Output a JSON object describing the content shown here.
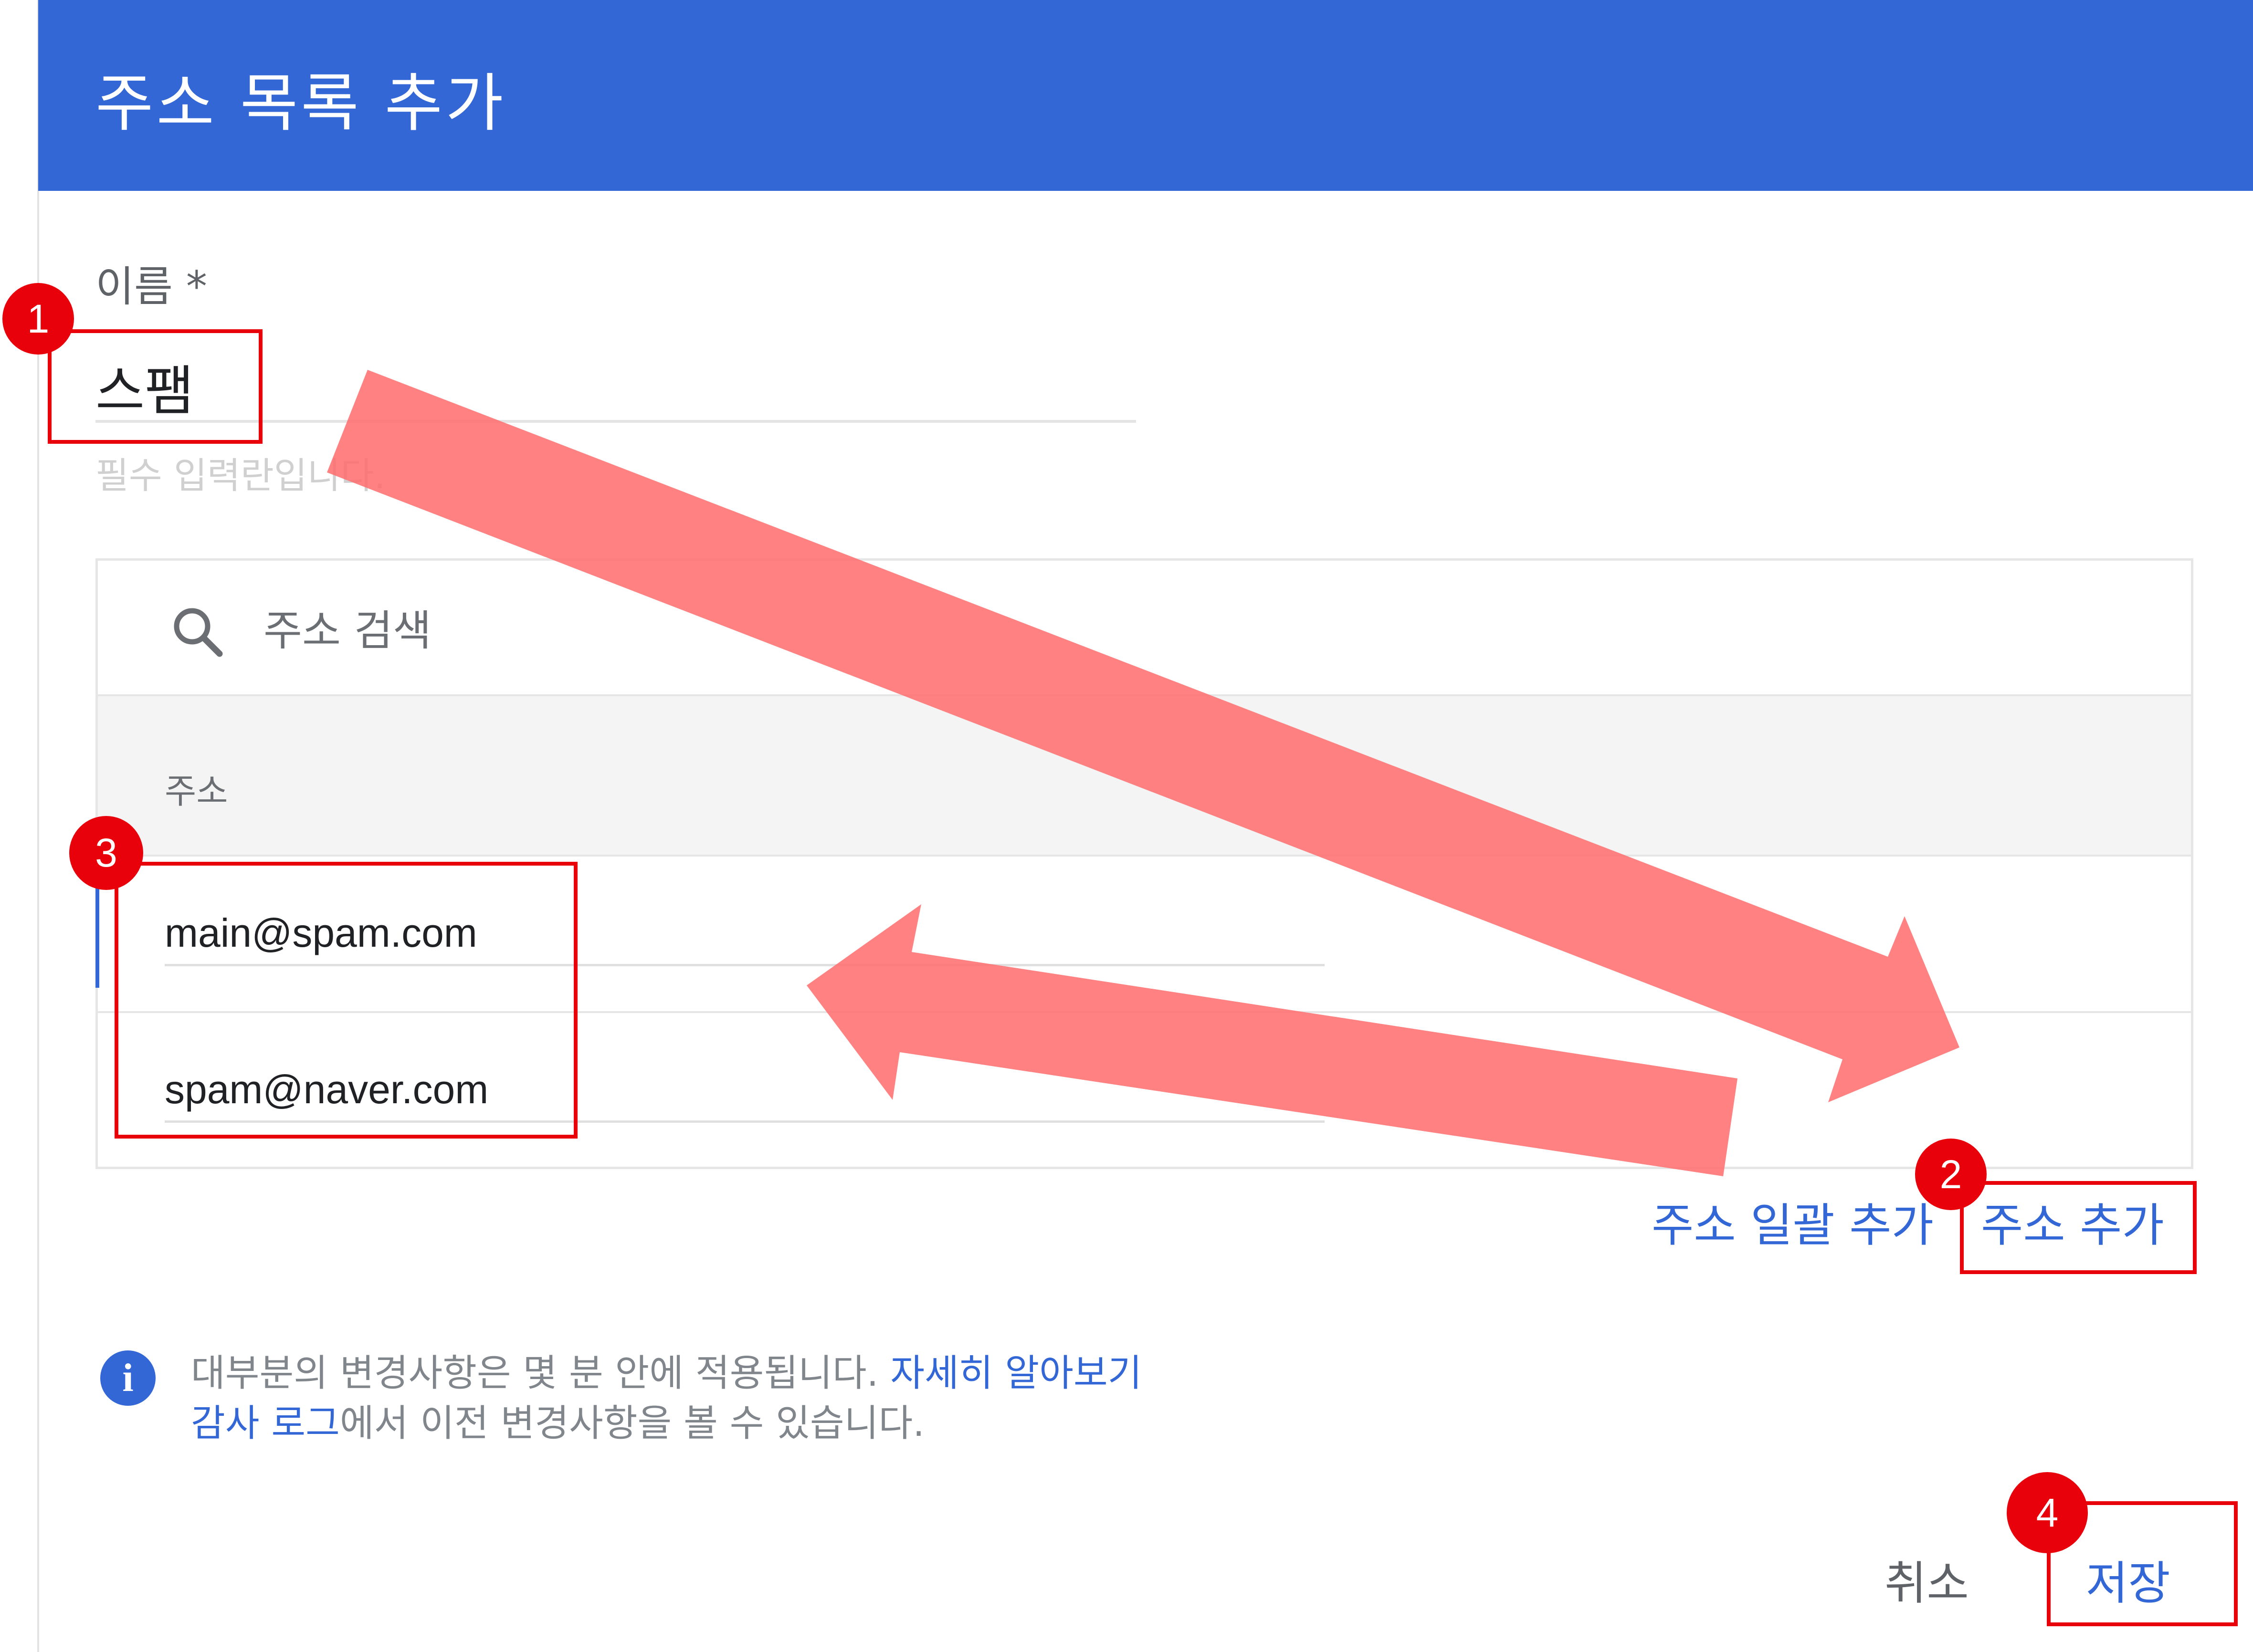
{
  "dialog": {
    "title": "주소 목록 추가",
    "name_label": "이름 *",
    "name_value": "스팸",
    "name_hint": "필수 입력란입니다.",
    "search_placeholder": "주소 검색",
    "column_header": "주소",
    "addresses": [
      "main@spam.com",
      "spam@naver.com"
    ],
    "bulk_add_label": "주소 일괄 추가",
    "add_label": "주소 추가",
    "info": {
      "line1_text": "대부분의 변경사항은 몇 분 안에 적용됩니다.",
      "line1_link": "자세히 알아보기",
      "line2_link": "감사 로그",
      "line2_text": "에서 이전 변경사항을 볼 수 있습니다."
    },
    "cancel_label": "취소",
    "save_label": "저장"
  },
  "annotations": {
    "badges": [
      "1",
      "2",
      "3",
      "4"
    ],
    "color": "#e8000b",
    "arrow_color": "#ff6b6b"
  },
  "colors": {
    "header": "#3367d6",
    "link": "#3367d6"
  }
}
